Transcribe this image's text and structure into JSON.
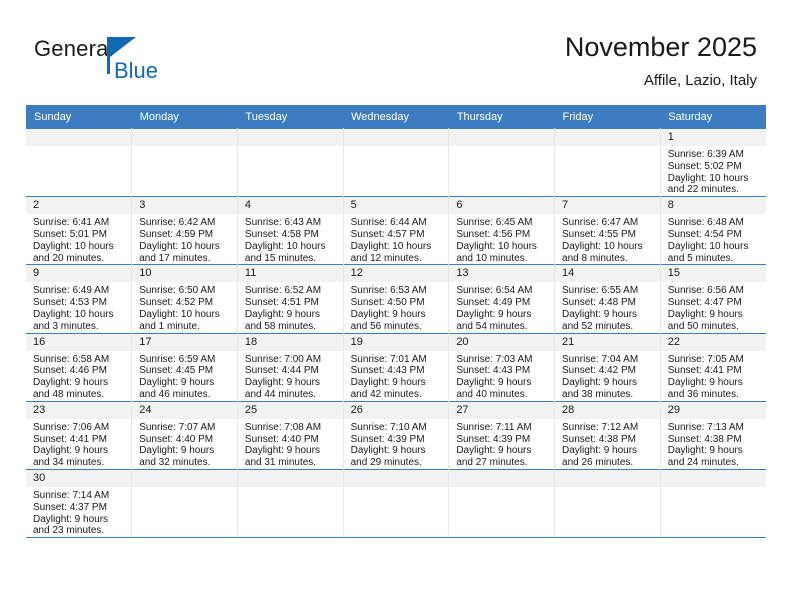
{
  "brand": {
    "name_top": "General",
    "name_bottom": "Blue",
    "logo_icon": "blue-triangle-logo",
    "color_black": "#1a1a1a",
    "color_blue": "#1268b3"
  },
  "header": {
    "title": "November 2025",
    "subtitle": "Affile, Lazio, Italy"
  },
  "colors": {
    "header_blue": "#3b7dc0",
    "daynum_band": "#f2f2f2",
    "grid_line": "#e7e7e7",
    "text": "#1a1a1a"
  },
  "weekday_headers": [
    "Sunday",
    "Monday",
    "Tuesday",
    "Wednesday",
    "Thursday",
    "Friday",
    "Saturday"
  ],
  "weeks": [
    [
      {
        "day": "",
        "empty": true
      },
      {
        "day": "",
        "empty": true
      },
      {
        "day": "",
        "empty": true
      },
      {
        "day": "",
        "empty": true
      },
      {
        "day": "",
        "empty": true
      },
      {
        "day": "",
        "empty": true
      },
      {
        "day": "1",
        "sunrise": "Sunrise: 6:39 AM",
        "sunset": "Sunset: 5:02 PM",
        "daylight": "Daylight: 10 hours and 22 minutes."
      }
    ],
    [
      {
        "day": "2",
        "sunrise": "Sunrise: 6:41 AM",
        "sunset": "Sunset: 5:01 PM",
        "daylight": "Daylight: 10 hours and 20 minutes."
      },
      {
        "day": "3",
        "sunrise": "Sunrise: 6:42 AM",
        "sunset": "Sunset: 4:59 PM",
        "daylight": "Daylight: 10 hours and 17 minutes."
      },
      {
        "day": "4",
        "sunrise": "Sunrise: 6:43 AM",
        "sunset": "Sunset: 4:58 PM",
        "daylight": "Daylight: 10 hours and 15 minutes."
      },
      {
        "day": "5",
        "sunrise": "Sunrise: 6:44 AM",
        "sunset": "Sunset: 4:57 PM",
        "daylight": "Daylight: 10 hours and 12 minutes."
      },
      {
        "day": "6",
        "sunrise": "Sunrise: 6:45 AM",
        "sunset": "Sunset: 4:56 PM",
        "daylight": "Daylight: 10 hours and 10 minutes."
      },
      {
        "day": "7",
        "sunrise": "Sunrise: 6:47 AM",
        "sunset": "Sunset: 4:55 PM",
        "daylight": "Daylight: 10 hours and 8 minutes."
      },
      {
        "day": "8",
        "sunrise": "Sunrise: 6:48 AM",
        "sunset": "Sunset: 4:54 PM",
        "daylight": "Daylight: 10 hours and 5 minutes."
      }
    ],
    [
      {
        "day": "9",
        "sunrise": "Sunrise: 6:49 AM",
        "sunset": "Sunset: 4:53 PM",
        "daylight": "Daylight: 10 hours and 3 minutes."
      },
      {
        "day": "10",
        "sunrise": "Sunrise: 6:50 AM",
        "sunset": "Sunset: 4:52 PM",
        "daylight": "Daylight: 10 hours and 1 minute."
      },
      {
        "day": "11",
        "sunrise": "Sunrise: 6:52 AM",
        "sunset": "Sunset: 4:51 PM",
        "daylight": "Daylight: 9 hours and 58 minutes."
      },
      {
        "day": "12",
        "sunrise": "Sunrise: 6:53 AM",
        "sunset": "Sunset: 4:50 PM",
        "daylight": "Daylight: 9 hours and 56 minutes."
      },
      {
        "day": "13",
        "sunrise": "Sunrise: 6:54 AM",
        "sunset": "Sunset: 4:49 PM",
        "daylight": "Daylight: 9 hours and 54 minutes."
      },
      {
        "day": "14",
        "sunrise": "Sunrise: 6:55 AM",
        "sunset": "Sunset: 4:48 PM",
        "daylight": "Daylight: 9 hours and 52 minutes."
      },
      {
        "day": "15",
        "sunrise": "Sunrise: 6:56 AM",
        "sunset": "Sunset: 4:47 PM",
        "daylight": "Daylight: 9 hours and 50 minutes."
      }
    ],
    [
      {
        "day": "16",
        "sunrise": "Sunrise: 6:58 AM",
        "sunset": "Sunset: 4:46 PM",
        "daylight": "Daylight: 9 hours and 48 minutes."
      },
      {
        "day": "17",
        "sunrise": "Sunrise: 6:59 AM",
        "sunset": "Sunset: 4:45 PM",
        "daylight": "Daylight: 9 hours and 46 minutes."
      },
      {
        "day": "18",
        "sunrise": "Sunrise: 7:00 AM",
        "sunset": "Sunset: 4:44 PM",
        "daylight": "Daylight: 9 hours and 44 minutes."
      },
      {
        "day": "19",
        "sunrise": "Sunrise: 7:01 AM",
        "sunset": "Sunset: 4:43 PM",
        "daylight": "Daylight: 9 hours and 42 minutes."
      },
      {
        "day": "20",
        "sunrise": "Sunrise: 7:03 AM",
        "sunset": "Sunset: 4:43 PM",
        "daylight": "Daylight: 9 hours and 40 minutes."
      },
      {
        "day": "21",
        "sunrise": "Sunrise: 7:04 AM",
        "sunset": "Sunset: 4:42 PM",
        "daylight": "Daylight: 9 hours and 38 minutes."
      },
      {
        "day": "22",
        "sunrise": "Sunrise: 7:05 AM",
        "sunset": "Sunset: 4:41 PM",
        "daylight": "Daylight: 9 hours and 36 minutes."
      }
    ],
    [
      {
        "day": "23",
        "sunrise": "Sunrise: 7:06 AM",
        "sunset": "Sunset: 4:41 PM",
        "daylight": "Daylight: 9 hours and 34 minutes."
      },
      {
        "day": "24",
        "sunrise": "Sunrise: 7:07 AM",
        "sunset": "Sunset: 4:40 PM",
        "daylight": "Daylight: 9 hours and 32 minutes."
      },
      {
        "day": "25",
        "sunrise": "Sunrise: 7:08 AM",
        "sunset": "Sunset: 4:40 PM",
        "daylight": "Daylight: 9 hours and 31 minutes."
      },
      {
        "day": "26",
        "sunrise": "Sunrise: 7:10 AM",
        "sunset": "Sunset: 4:39 PM",
        "daylight": "Daylight: 9 hours and 29 minutes."
      },
      {
        "day": "27",
        "sunrise": "Sunrise: 7:11 AM",
        "sunset": "Sunset: 4:39 PM",
        "daylight": "Daylight: 9 hours and 27 minutes."
      },
      {
        "day": "28",
        "sunrise": "Sunrise: 7:12 AM",
        "sunset": "Sunset: 4:38 PM",
        "daylight": "Daylight: 9 hours and 26 minutes."
      },
      {
        "day": "29",
        "sunrise": "Sunrise: 7:13 AM",
        "sunset": "Sunset: 4:38 PM",
        "daylight": "Daylight: 9 hours and 24 minutes."
      }
    ],
    [
      {
        "day": "30",
        "sunrise": "Sunrise: 7:14 AM",
        "sunset": "Sunset: 4:37 PM",
        "daylight": "Daylight: 9 hours and 23 minutes."
      },
      {
        "day": "",
        "empty": true
      },
      {
        "day": "",
        "empty": true
      },
      {
        "day": "",
        "empty": true
      },
      {
        "day": "",
        "empty": true
      },
      {
        "day": "",
        "empty": true
      },
      {
        "day": "",
        "empty": true
      }
    ]
  ]
}
